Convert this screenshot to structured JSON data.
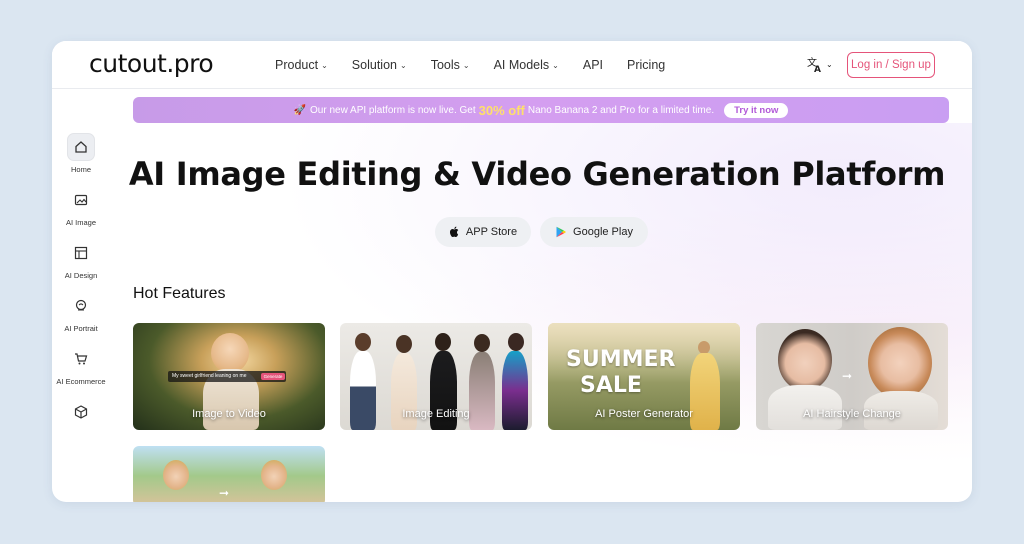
{
  "header": {
    "logo": "cutout.pro",
    "nav": [
      {
        "label": "Product",
        "has_dropdown": true
      },
      {
        "label": "Solution",
        "has_dropdown": true
      },
      {
        "label": "Tools",
        "has_dropdown": true
      },
      {
        "label": "AI Models",
        "has_dropdown": true
      },
      {
        "label": "API",
        "has_dropdown": false
      },
      {
        "label": "Pricing",
        "has_dropdown": false
      }
    ],
    "language_icon": "translate-icon",
    "login_label": "Log in / Sign up"
  },
  "promo": {
    "text_before": "Our new API platform is now live. Get",
    "highlight": "30% off",
    "text_after": "Nano Banana 2 and Pro for a limited time.",
    "button_label": "Try it now"
  },
  "sidebar": {
    "items": [
      {
        "label": "Home",
        "icon": "home-icon",
        "active": true
      },
      {
        "label": "AI Image",
        "icon": "image-icon",
        "active": false
      },
      {
        "label": "AI Design",
        "icon": "layout-icon",
        "active": false
      },
      {
        "label": "AI Portrait",
        "icon": "portrait-icon",
        "active": false
      },
      {
        "label": "AI Ecommerce",
        "icon": "cart-icon",
        "active": false
      },
      {
        "label": "",
        "icon": "cube-icon",
        "active": false
      }
    ]
  },
  "hero": {
    "title": "AI Image Editing & Video Generation Platform",
    "app_store_label": "APP Store",
    "google_play_label": "Google Play"
  },
  "hot_features": {
    "title": "Hot Features",
    "cards": [
      {
        "label": "Image to Video",
        "overlay_text": "My sweet girlfriend leaning on me",
        "overlay_button": "Generate"
      },
      {
        "label": "Image Editing"
      },
      {
        "label": "AI Poster Generator",
        "poster_text_1": "SUMMER",
        "poster_text_2": "SALE"
      },
      {
        "label": "AI Hairstyle Change"
      },
      {
        "label": ""
      }
    ]
  },
  "colors": {
    "accent": "#e5547a",
    "promo_gradient_start": "#c79be8",
    "promo_highlight": "#ffe06a",
    "page_background": "#dbe6f1"
  }
}
